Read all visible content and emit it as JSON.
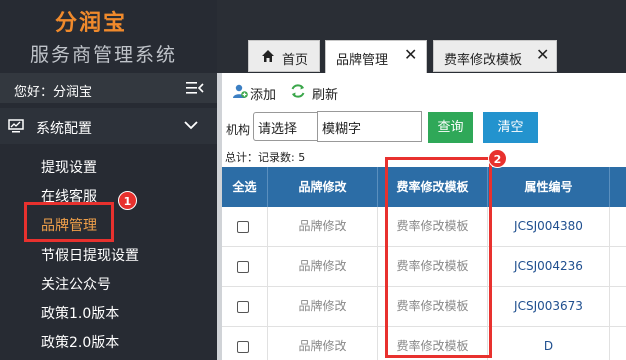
{
  "app": {
    "brand": "分润宝",
    "subtitle": "服务商管理系统"
  },
  "sidebar": {
    "greeting": "您好：分润宝",
    "section": "系统配置",
    "items": [
      {
        "label": "提现设置"
      },
      {
        "label": "在线客服"
      },
      {
        "label": "品牌管理"
      },
      {
        "label": "节假日提现设置"
      },
      {
        "label": "关注公众号"
      },
      {
        "label": "政策1.0版本"
      },
      {
        "label": "政策2.0版本"
      }
    ]
  },
  "tabs": [
    {
      "label": "首页"
    },
    {
      "label": "品牌管理"
    },
    {
      "label": "费率修改模板"
    }
  ],
  "toolbar": {
    "add_label": "添加",
    "refresh_label": "刷新"
  },
  "filters": {
    "org_label": "机构",
    "select_value": "请选择",
    "input_value": "模糊字",
    "query_label": "查询",
    "clear_label": "清空"
  },
  "summary": "总计：记录数: 5",
  "table": {
    "headers": [
      "全选",
      "品牌修改",
      "费率修改模板",
      "属性编号"
    ],
    "rows": [
      {
        "col1": "品牌修改",
        "col2": "费率修改模板",
        "code": "JCSJ004380"
      },
      {
        "col1": "品牌修改",
        "col2": "费率修改模板",
        "code": "JCSJ004236"
      },
      {
        "col1": "品牌修改",
        "col2": "费率修改模板",
        "code": "JCSJ003673"
      },
      {
        "col1": "品牌修改",
        "col2": "费率修改模板",
        "code": "D"
      }
    ]
  },
  "annotations": {
    "badge1": "1",
    "badge2": "2"
  },
  "colors": {
    "highlight": "#e8312e",
    "header": "#2c6da6",
    "query": "#2fa858",
    "clear": "#2393ce",
    "brand": "#f08a2c"
  }
}
